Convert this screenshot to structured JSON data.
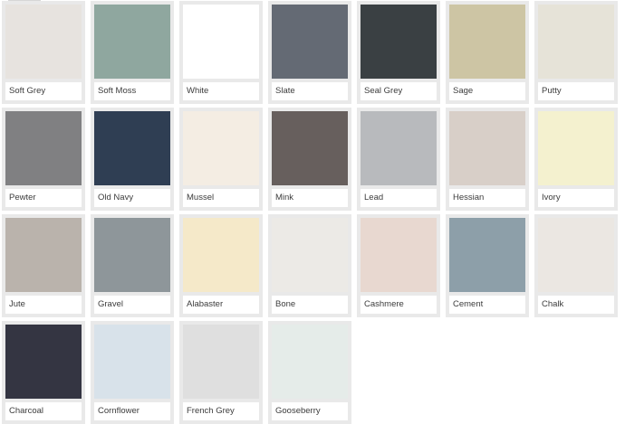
{
  "swatches": [
    {
      "name": "Soft Grey",
      "color": "#e7e3df"
    },
    {
      "name": "Soft Moss",
      "color": "#8fa79f"
    },
    {
      "name": "White",
      "color": "#ffffff"
    },
    {
      "name": "Slate",
      "color": "#646a74"
    },
    {
      "name": "Seal Grey",
      "color": "#3a4043"
    },
    {
      "name": "Sage",
      "color": "#cdc5a4"
    },
    {
      "name": "Putty",
      "color": "#e6e3d8"
    },
    {
      "name": "Pewter",
      "color": "#808082"
    },
    {
      "name": "Old Navy",
      "color": "#2f3e53"
    },
    {
      "name": "Mussel",
      "color": "#f4ede3"
    },
    {
      "name": "Mink",
      "color": "#675f5d"
    },
    {
      "name": "Lead",
      "color": "#b8babd"
    },
    {
      "name": "Hessian",
      "color": "#d8cfc8"
    },
    {
      "name": "Ivory",
      "color": "#f4f1cf"
    },
    {
      "name": "Jute",
      "color": "#bab3ac"
    },
    {
      "name": "Gravel",
      "color": "#8e969a"
    },
    {
      "name": "Alabaster",
      "color": "#f5e9c9"
    },
    {
      "name": "Bone",
      "color": "#eceae6"
    },
    {
      "name": "Cashmere",
      "color": "#e8d8d0"
    },
    {
      "name": "Cement",
      "color": "#8d9fa9"
    },
    {
      "name": "Chalk",
      "color": "#ebe7e2"
    },
    {
      "name": "Charcoal",
      "color": "#343542"
    },
    {
      "name": "Cornflower",
      "color": "#d8e2ea"
    },
    {
      "name": "French Grey",
      "color": "#dfdfdf"
    },
    {
      "name": "Gooseberry",
      "color": "#e5ece9"
    }
  ]
}
